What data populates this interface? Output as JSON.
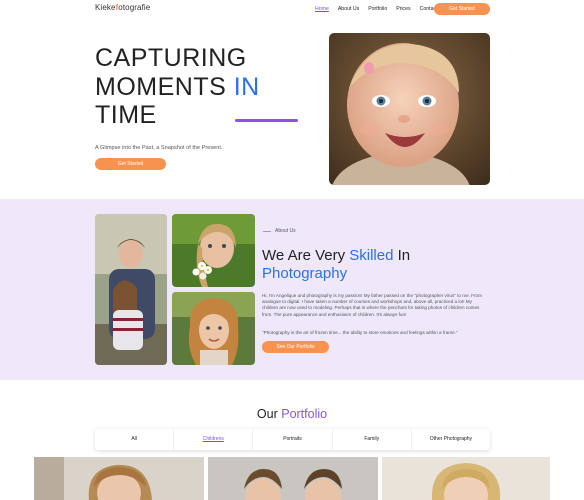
{
  "nav": {
    "logo_prefix": "Kieke",
    "logo_f": "f",
    "logo_suffix": "otografie",
    "items": [
      "Home",
      "About Us",
      "Portfolio",
      "Prices",
      "Contact Us"
    ],
    "cta": "Get Started"
  },
  "hero": {
    "title_line1": "CAPTURING",
    "title_line2_a": "MOMENTS",
    "title_line2_b": "IN",
    "title_line3": "TIME",
    "subtitle": "A Glimpse into the Past, a Snapshot of the Present.",
    "button": "Get Started"
  },
  "about": {
    "tag": "About Us",
    "title_a": "We Are Very",
    "title_b": "Skilled",
    "title_c": "In",
    "title_d": "Photography",
    "paragraph1": "Hi, I'm Angelique and photography is my passion! My father passed on the \"photographer virus\" to me. From analogue to digital. I have taken a number of courses and workshops and, above all, practiced a lot! My children are now used to modeling. Perhaps that is where the penchant for taking photos of children comes from. The pure appearance and enthusiasm of children. It's always fun!",
    "paragraph2": "\"Photography is the art of frozen time... the ability to store emotions and feelings within a frame.\"",
    "button": "See Our Portfolio"
  },
  "portfolio": {
    "title_a": "Our",
    "title_b": "Portfolio",
    "tabs": [
      "All",
      "Childrens",
      "Portraits",
      "Family",
      "Other Photography"
    ],
    "active_tab": "Childrens"
  },
  "colors": {
    "accent_orange": "#f7934f",
    "accent_blue": "#2d6fe8",
    "accent_purple": "#8a54e8",
    "section_bg": "#efe8fb"
  }
}
